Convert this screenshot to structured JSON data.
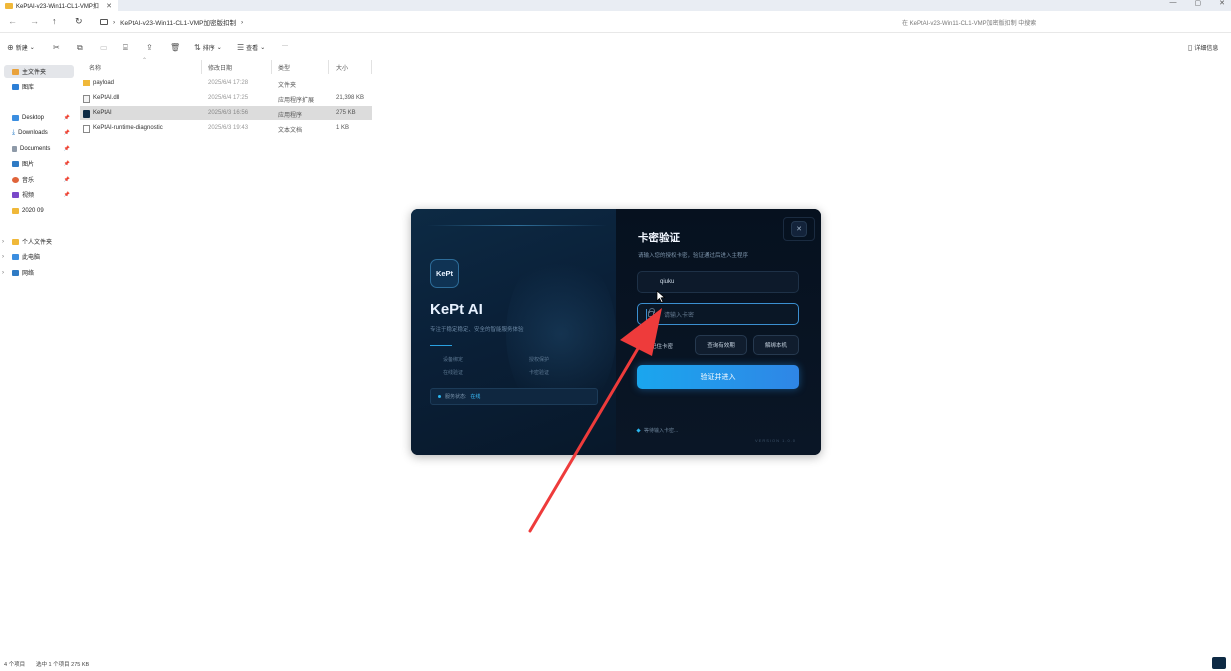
{
  "window": {
    "tab_title": "KePtAI-v23-Win11-CL1-VMP扣",
    "tab_close": "✕",
    "controls": [
      "—",
      "▢",
      "✕"
    ]
  },
  "address": {
    "back": "←",
    "forward": "→",
    "up": "↑",
    "refresh": "↻",
    "path_sep": "›",
    "path": "KePtAI-v23-Win11-CL1-VMP加密版扣制",
    "search_placeholder": "在 KePtAI-v23-Win11-CL1-VMP加密版扣制 中搜索"
  },
  "toolbar": {
    "new_label": "新建",
    "sort_label": "排序",
    "view_label": "查看",
    "more": "···",
    "details_label": "详细信息"
  },
  "sidebar": {
    "items": [
      {
        "label": "主文件夹",
        "icon": "home-icon"
      },
      {
        "label": "图库",
        "icon": "gallery-icon"
      },
      {
        "label": "Desktop",
        "icon": "desktop-icon"
      },
      {
        "label": "Downloads",
        "icon": "download-icon"
      },
      {
        "label": "Documents",
        "icon": "document-icon"
      },
      {
        "label": "图片",
        "icon": "picture-icon"
      },
      {
        "label": "音乐",
        "icon": "music-icon"
      },
      {
        "label": "视频",
        "icon": "video-icon"
      },
      {
        "label": "2020 09",
        "icon": "folder-icon"
      },
      {
        "label": "个人文件夹",
        "icon": "folder-icon"
      },
      {
        "label": "此电脑",
        "icon": "computer-icon"
      },
      {
        "label": "网络",
        "icon": "network-icon"
      }
    ],
    "pin": "📌",
    "chevron": "›"
  },
  "files": {
    "columns": [
      "名称",
      "修改日期",
      "类型",
      "大小"
    ],
    "rows": [
      {
        "name": "payload",
        "date": "2025/6/4 17:28",
        "type": "文件夹",
        "size": ""
      },
      {
        "name": "KePtAI.dll",
        "date": "2025/6/4 17:25",
        "type": "应用程序扩展",
        "size": "21,398 KB"
      },
      {
        "name": "KePtAI",
        "date": "2025/6/3 16:56",
        "type": "应用程序",
        "size": "275 KB"
      },
      {
        "name": "KePtAI-runtime-diagnostic",
        "date": "2025/6/3 19:43",
        "type": "文本文档",
        "size": "1 KB"
      }
    ]
  },
  "status": {
    "count": "4 个项目",
    "selected": "选中 1 个项目  275 KB"
  },
  "dialog": {
    "logo_text": "KePt",
    "brand": "KePt AI",
    "tagline": "专注于稳定稳定、安全的智能服务体验",
    "features": [
      "设备绑定",
      "授权保护",
      "在线验证",
      "卡密验证"
    ],
    "status_prefix": "服务状态:",
    "status_value": "在线",
    "close": "✕",
    "title": "卡密验证",
    "subtitle": "请输入您的授权卡密，验证通过后进入主程序",
    "username_value": "qiuku",
    "card_placeholder": "请输入卡密",
    "remember_label": "记住卡密",
    "check_mark": "✓",
    "query_button": "查询有效期",
    "unbind_button": "解绑本机",
    "submit_button": "验证并进入",
    "footer_text": "等待输入卡密...",
    "version": "VERSION 1.0.0"
  },
  "annotation": {
    "arrow_color": "#ee3b3b"
  }
}
